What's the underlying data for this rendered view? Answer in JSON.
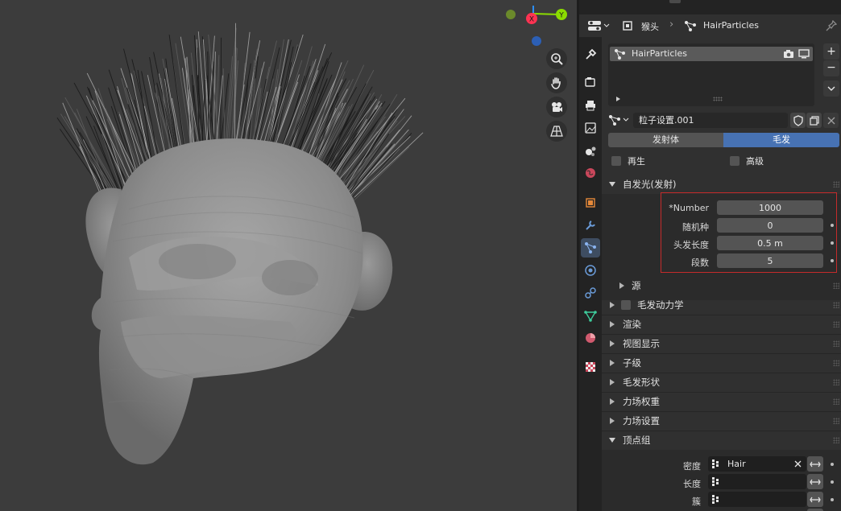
{
  "viewport": {
    "gizmo": {
      "x_label": "X",
      "y_label": "Y"
    },
    "nav_icons": [
      "zoom-icon",
      "hand-pan-icon",
      "camera-icon",
      "grid-perspective-icon"
    ]
  },
  "header": {
    "object_name": "猴头",
    "particle_system_name": "HairParticles"
  },
  "particle_list": {
    "items": [
      "HairParticles"
    ]
  },
  "settings": {
    "name": "粒子设置.001",
    "type_tabs": [
      "发射体",
      "毛发"
    ],
    "active_type": "毛发",
    "regenerate_label": "再生",
    "advanced_label": "高级"
  },
  "emission": {
    "title": "自发光(发射)",
    "fields": [
      {
        "label": "*Number",
        "value": "1000"
      },
      {
        "label": "随机种",
        "value": "0"
      },
      {
        "label": "头发长度",
        "value": "0.5 m"
      },
      {
        "label": "段数",
        "value": "5"
      }
    ],
    "source_label": "源"
  },
  "sections": [
    "毛发动力学",
    "渲染",
    "视图显示",
    "子级",
    "毛发形状",
    "力场权重",
    "力场设置"
  ],
  "vertex_groups": {
    "title": "顶点组",
    "rows": [
      {
        "label": "密度",
        "value": "Hair"
      },
      {
        "label": "长度",
        "value": ""
      },
      {
        "label": "簇",
        "value": ""
      }
    ]
  },
  "colors": {
    "accent": "#4772b3",
    "highlight_box": "#c42b2b",
    "axis_x": "#ff3352",
    "axis_y": "#8bdc00",
    "axis_z": "#2c8fff"
  }
}
